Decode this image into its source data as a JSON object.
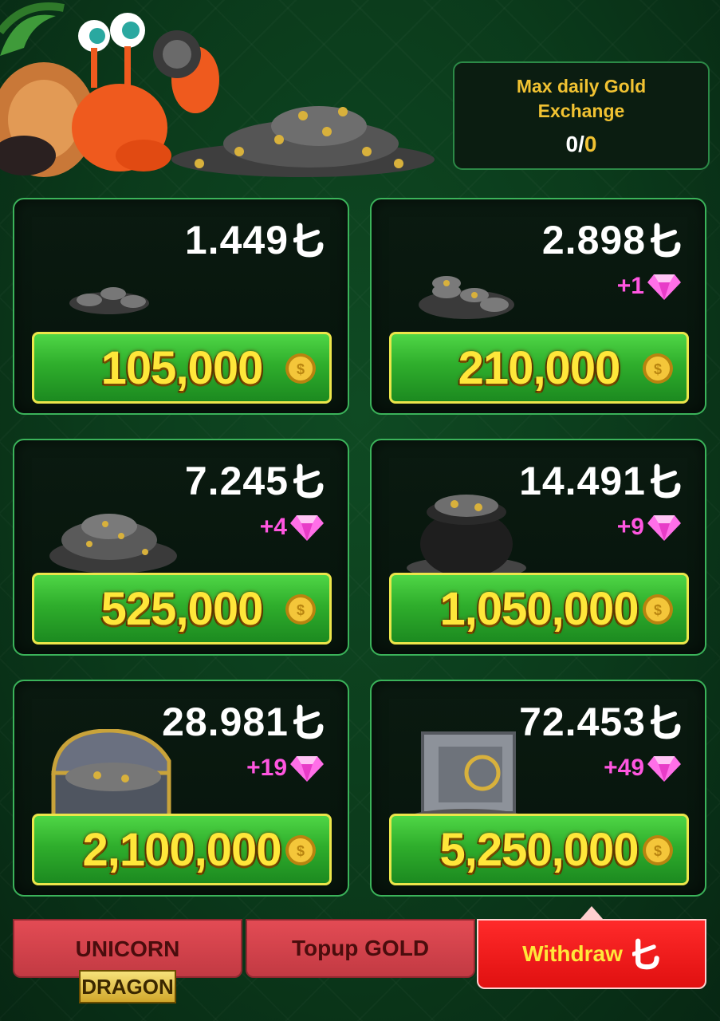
{
  "header": {
    "limit_title": "Max daily Gold Exchange",
    "limit_used": "0",
    "limit_separator": "/",
    "limit_max": "0"
  },
  "packages": [
    {
      "price": "1.449",
      "bonus": "",
      "amount": "105,000",
      "art": "small-coins-icon"
    },
    {
      "price": "2.898",
      "bonus": "+1",
      "amount": "210,000",
      "art": "coins-stack-icon"
    },
    {
      "price": "7.245",
      "bonus": "+4",
      "amount": "525,000",
      "art": "coin-pile-icon"
    },
    {
      "price": "14.491",
      "bonus": "+9",
      "amount": "1,050,000",
      "art": "pot-of-coins-icon"
    },
    {
      "price": "28.981",
      "bonus": "+19",
      "amount": "2,100,000",
      "art": "treasure-chest-icon"
    },
    {
      "price": "72.453",
      "bonus": "+49",
      "amount": "5,250,000",
      "art": "vault-icon"
    }
  ],
  "nav": {
    "tab1": "UNICORN",
    "tab1_badge": "DRAGON",
    "tab2": "Topup GOLD",
    "tab3": "Withdraw"
  },
  "colors": {
    "background": "#0b3a1b",
    "button_green": "#2fae2c",
    "amount_yellow": "#ffe73a",
    "gem_pink": "#ff56e0",
    "active_tab": "#e01010"
  }
}
